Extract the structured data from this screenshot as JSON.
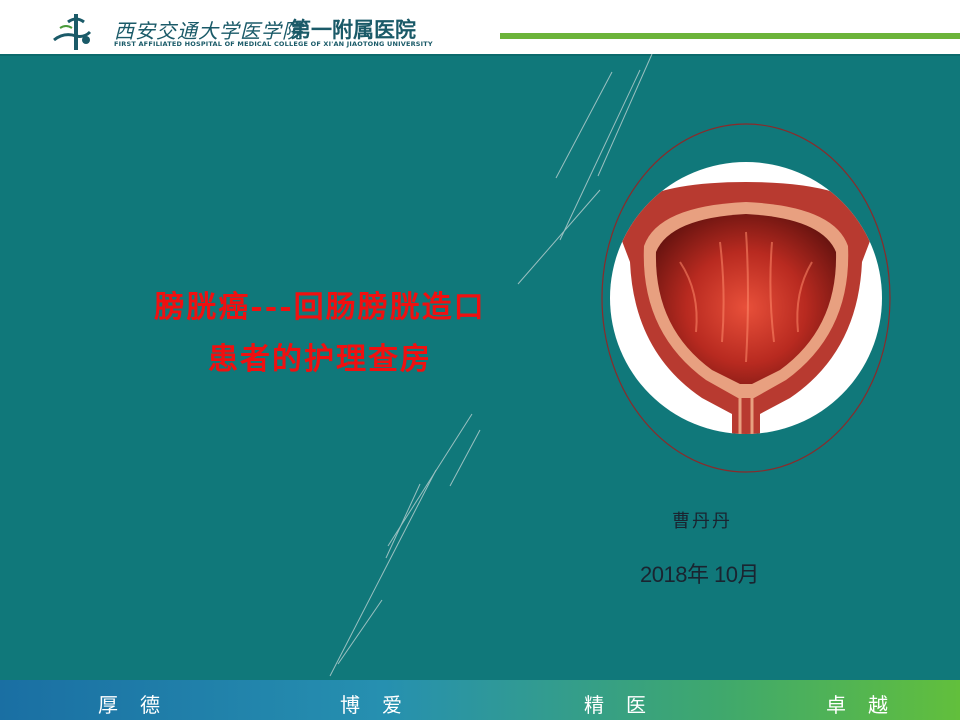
{
  "header": {
    "logo_icon": "hospital-logo-icon",
    "school_name": "西安交通大学医学院",
    "hospital_name": "第一附属医院",
    "english_name": "FIRST AFFILIATED HOSPITAL OF MEDICAL COLLEGE OF XI'AN JIAOTONG UNIVERSITY",
    "accent_color": "#6cb43a"
  },
  "slide": {
    "background_color": "#10787a",
    "title_lines": [
      "膀胱癌---回肠膀胱造口",
      "患者的护理查房"
    ],
    "title_color": "#f01010",
    "image_icon": "bladder-illustration",
    "author": "曹丹丹",
    "date": "2018年 10月"
  },
  "footer": {
    "motto": [
      "厚德",
      "博爱",
      "精医",
      "卓越"
    ]
  }
}
